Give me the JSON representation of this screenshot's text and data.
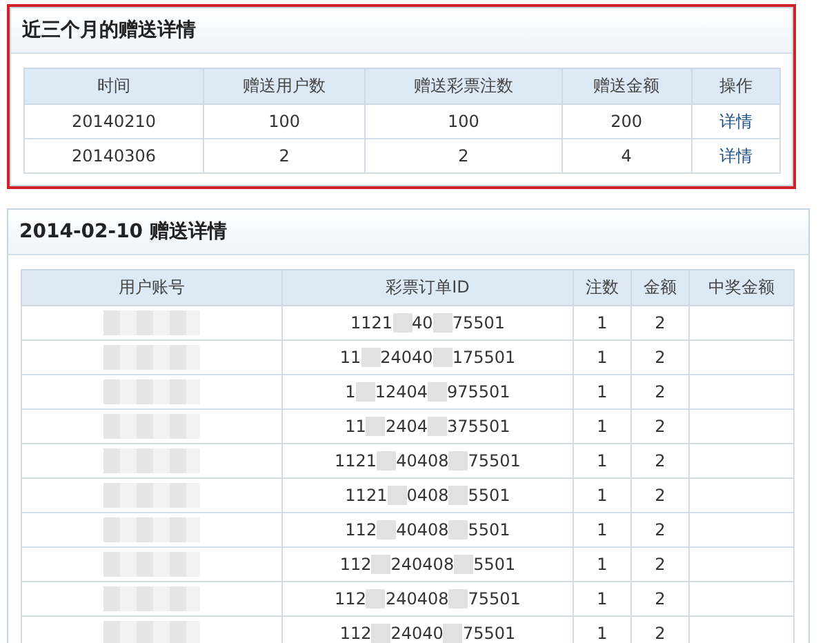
{
  "summary_panel": {
    "title": "近三个月的赠送详情",
    "highlighted": true,
    "columns": [
      "时间",
      "赠送用户数",
      "赠送彩票注数",
      "赠送金额",
      "操作"
    ],
    "rows": [
      {
        "cells": [
          "20140210",
          "100",
          "100",
          "200"
        ],
        "action": "详情"
      },
      {
        "cells": [
          "20140306",
          "2",
          "2",
          "4"
        ],
        "action": "详情"
      }
    ]
  },
  "detail_panel": {
    "title": "2014-02-10 赠送详情",
    "columns": [
      "用户账号",
      "彩票订单ID",
      "注数",
      "金额",
      "中奖金额"
    ],
    "rows": [
      {
        "order_id_parts": [
          "1121",
          "40",
          "75501"
        ],
        "count": "1",
        "amount": "2"
      },
      {
        "order_id_parts": [
          "11",
          "24040",
          "175501"
        ],
        "count": "1",
        "amount": "2"
      },
      {
        "order_id_parts": [
          "1",
          "12404",
          "975501"
        ],
        "count": "1",
        "amount": "2"
      },
      {
        "order_id_parts": [
          "11",
          "2404",
          "375501"
        ],
        "count": "1",
        "amount": "2"
      },
      {
        "order_id_parts": [
          "1121",
          "40408",
          "75501"
        ],
        "count": "1",
        "amount": "2"
      },
      {
        "order_id_parts": [
          "1121",
          "0408",
          "5501"
        ],
        "count": "1",
        "amount": "2"
      },
      {
        "order_id_parts": [
          "112",
          "40408",
          "5501"
        ],
        "count": "1",
        "amount": "2"
      },
      {
        "order_id_parts": [
          "112",
          "240408",
          "5501"
        ],
        "count": "1",
        "amount": "2"
      },
      {
        "order_id_parts": [
          "112",
          "240408",
          "75501"
        ],
        "count": "1",
        "amount": "2"
      },
      {
        "order_id_parts": [
          "112",
          "24040",
          "75501"
        ],
        "count": "1",
        "amount": "2"
      }
    ]
  }
}
